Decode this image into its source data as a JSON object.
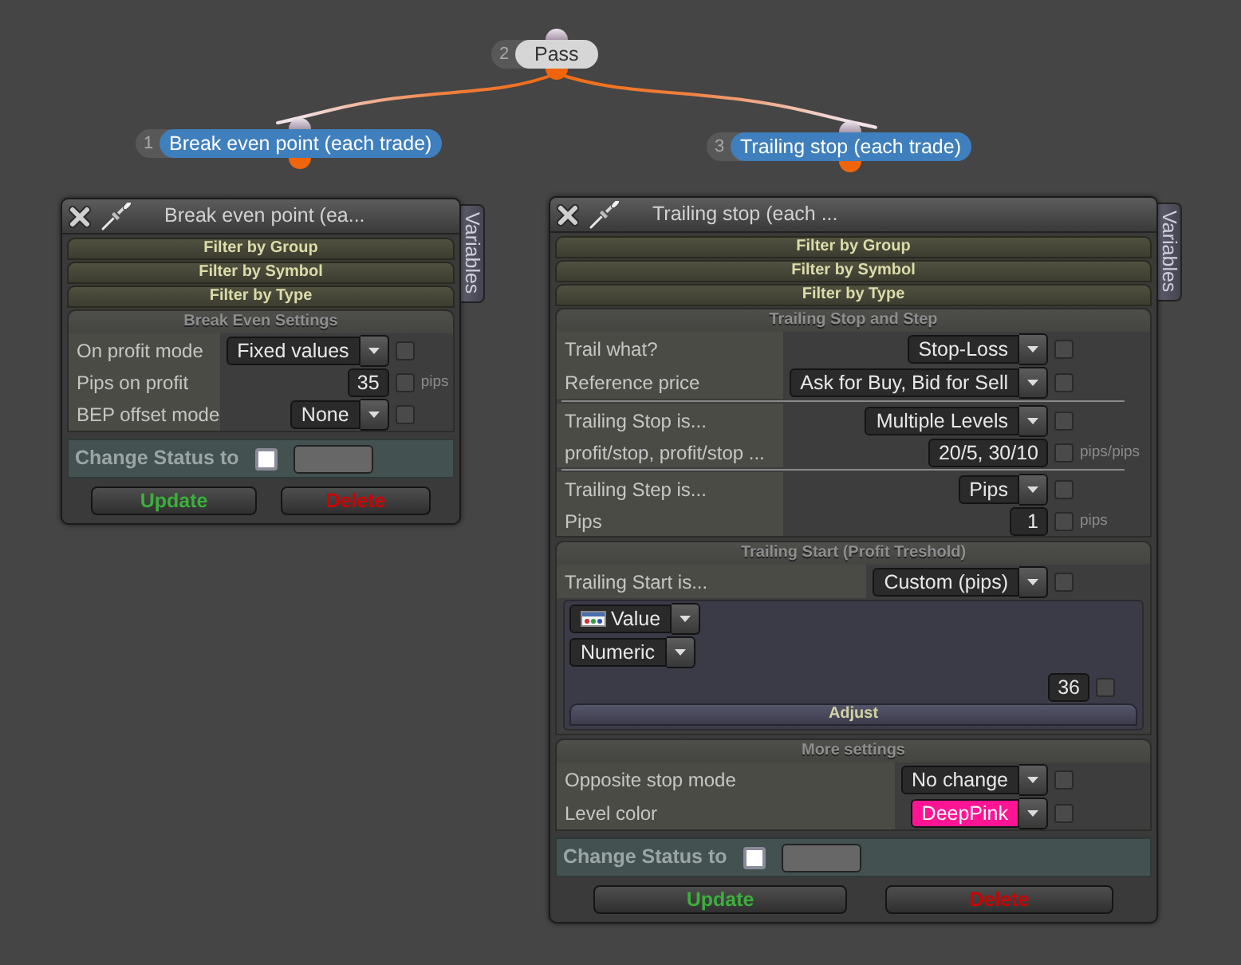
{
  "flow": {
    "number": "2",
    "label": "Pass",
    "kind": "pass",
    "children": [
      {
        "number": "1",
        "label": "Break even point (each trade)",
        "kind": "action"
      },
      {
        "number": "3",
        "label": "Trailing stop (each trade)",
        "kind": "action"
      }
    ]
  },
  "panels": [
    {
      "title": "Break even point (ea...",
      "side_tab": "Variables",
      "filters": [
        "Filter by Group",
        "Filter by Symbol",
        "Filter by Type"
      ],
      "sections": [
        {
          "title": "Break Even Settings",
          "groups": [
            [
              {
                "kind": "select",
                "label": "On profit mode",
                "value": "Fixed values",
                "checked": false
              },
              {
                "kind": "number",
                "label": "Pips on profit",
                "value": "35",
                "unit": "pips",
                "checked": false
              },
              {
                "kind": "select",
                "label": "BEP offset mode",
                "value": "None",
                "checked": false
              }
            ]
          ]
        }
      ],
      "status": {
        "label": "Change Status to",
        "checked": false
      },
      "buttons": [
        {
          "kind": "update",
          "label": "Update"
        },
        {
          "kind": "delete",
          "label": "Delete"
        }
      ]
    },
    {
      "title": "Trailing stop (each ...",
      "side_tab": "Variables",
      "filters": [
        "Filter by Group",
        "Filter by Symbol",
        "Filter by Type"
      ],
      "sections": [
        {
          "title": "Trailing Stop and Step",
          "groups": [
            [
              {
                "kind": "select",
                "label": "Trail what?",
                "value": "Stop-Loss",
                "checked": false
              },
              {
                "kind": "select",
                "label": "Reference price",
                "value": "Ask for Buy, Bid for Sell",
                "checked": false
              }
            ],
            [
              {
                "kind": "select",
                "label": "Trailing Stop is...",
                "value": "Multiple Levels",
                "checked": false
              },
              {
                "kind": "number",
                "label": "profit/stop, profit/stop ...",
                "value": "20/5, 30/10",
                "unit": "pips/pips",
                "checked": false
              }
            ],
            [
              {
                "kind": "select",
                "label": "Trailing Step is...",
                "value": "Pips",
                "checked": false
              },
              {
                "kind": "number",
                "label": "Pips",
                "value": "1",
                "unit": "pips",
                "checked": false
              }
            ]
          ]
        },
        {
          "title": "Trailing Start (Profit Treshold)",
          "groups": [
            [
              {
                "kind": "select",
                "label": "Trailing Start is...",
                "value": "Custom (pips)",
                "checked": false
              }
            ]
          ],
          "editor": {
            "selects": [
              "Value",
              "Numeric"
            ],
            "value": "36",
            "checked": false,
            "button": "Adjust"
          }
        },
        {
          "title": "More settings",
          "groups": [
            [
              {
                "kind": "select",
                "label": "Opposite stop mode",
                "value": "No change",
                "checked": false
              },
              {
                "kind": "color",
                "label": "Level color",
                "value": "DeepPink",
                "color": "#ff1493",
                "checked": false
              }
            ]
          ]
        }
      ],
      "status": {
        "label": "Change Status to",
        "checked": false
      },
      "buttons": [
        {
          "kind": "update",
          "label": "Update"
        },
        {
          "kind": "delete",
          "label": "Delete"
        }
      ]
    }
  ]
}
